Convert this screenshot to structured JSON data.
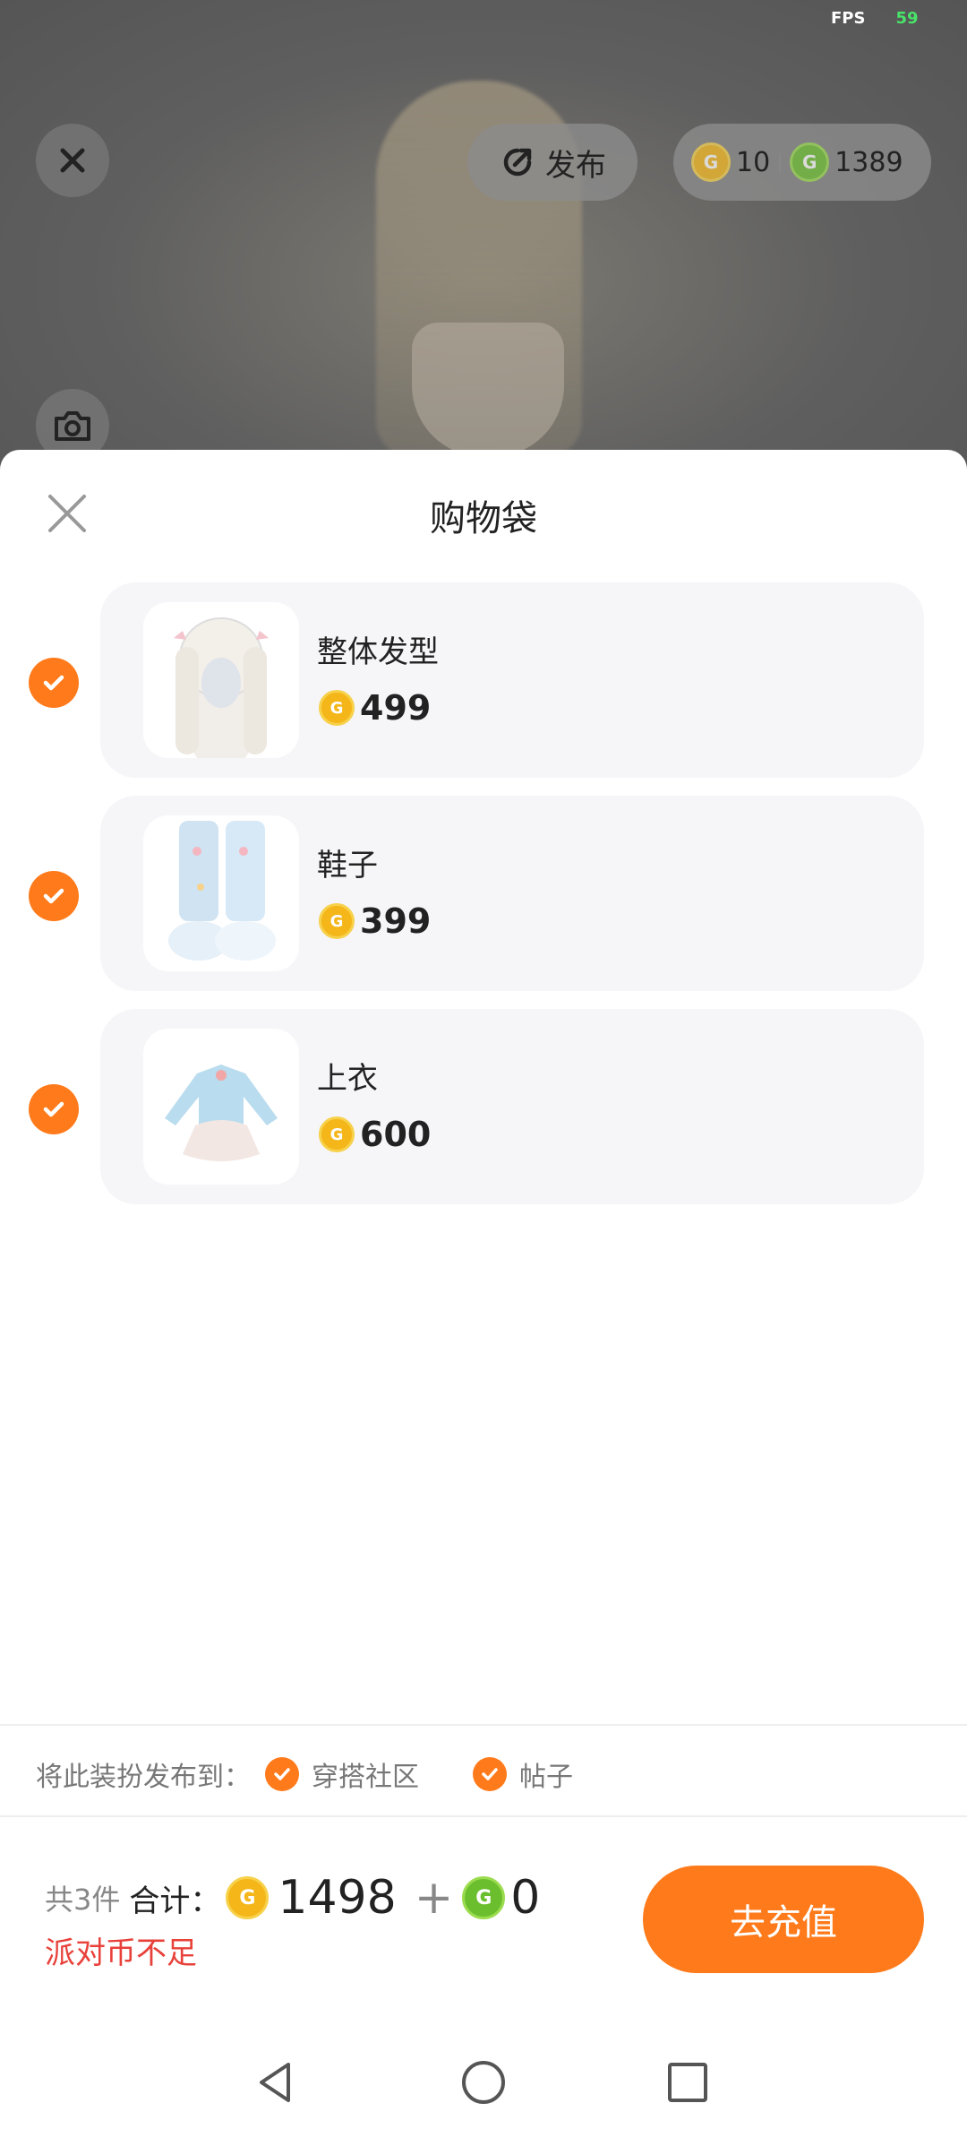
{
  "status": {
    "fps_label": "FPS",
    "fps_value": "59"
  },
  "header": {
    "publish_label": "发布",
    "party_coins": "10",
    "coins": "1389"
  },
  "sheet": {
    "title": "购物袋",
    "items": [
      {
        "name": "整体发型",
        "price": "499",
        "checked": true
      },
      {
        "name": "鞋子",
        "price": "399",
        "checked": true
      },
      {
        "name": "上衣",
        "price": "600",
        "checked": true
      }
    ]
  },
  "publish_to": {
    "label": "将此装扮发布到：",
    "options": [
      {
        "label": "穿搭社区",
        "checked": true
      },
      {
        "label": "帖子",
        "checked": true
      }
    ]
  },
  "footer": {
    "count": "共3件",
    "total_label": "合计：",
    "gold_total": "1498",
    "plus": "+",
    "green_total": "0",
    "warning": "派对币不足",
    "recharge_label": "去充值"
  },
  "colors": {
    "accent": "#ff7a1a",
    "warning": "#e8413a",
    "gold_coin": "#f4b619",
    "green_coin": "#6bbf2e"
  },
  "icons": [
    "close-icon",
    "publish-icon",
    "camera-icon",
    "check-icon",
    "gold-coin-icon",
    "green-coin-icon",
    "back-icon",
    "home-icon",
    "recents-icon"
  ]
}
